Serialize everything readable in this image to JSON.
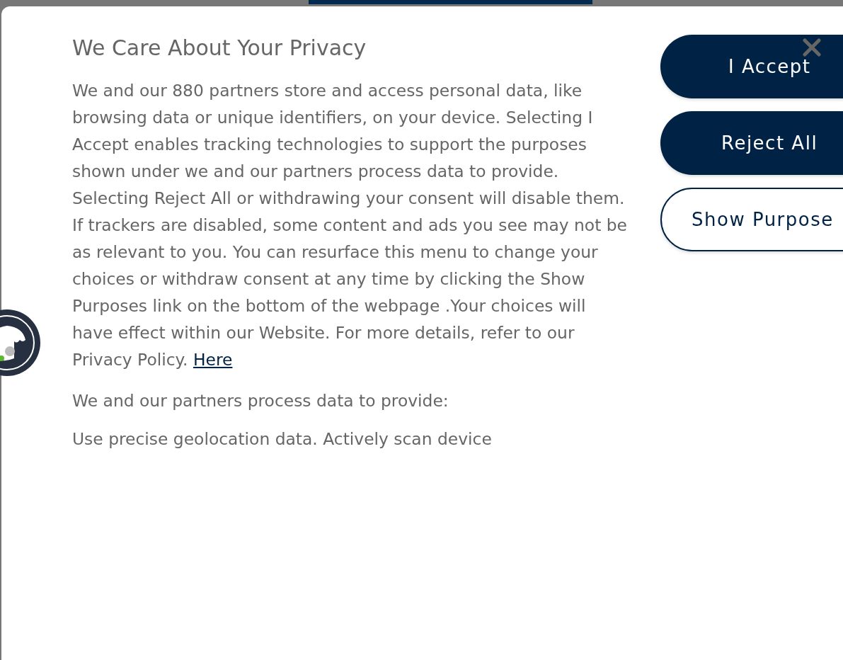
{
  "dialog": {
    "title": "We Care About Your Privacy",
    "body": "We and our 880 partners store and access personal data, like browsing data or unique identifiers, on your device. Selecting I Accept enables tracking technologies to support the purposes shown under we and our partners process data to provide. Selecting Reject All or withdrawing your consent will disable them. If trackers are disabled, some content and ads you see may not be as relevant to you. You can resurface this menu to change your choices or withdraw consent at any time by clicking the Show Purposes link on the bottom of the webpage .Your choices will have effect within our Website. For more details, refer to our Privacy Policy.",
    "link": "Here",
    "purposes_heading": "We and our partners process data to provide:",
    "purposes": "Use precise geolocation data. Actively scan device",
    "buttons": [
      {
        "label": "I Accept",
        "kind": "primary"
      },
      {
        "label": "Reject All",
        "kind": "primary"
      },
      {
        "label": "Show Purpose",
        "kind": "outline"
      }
    ]
  }
}
